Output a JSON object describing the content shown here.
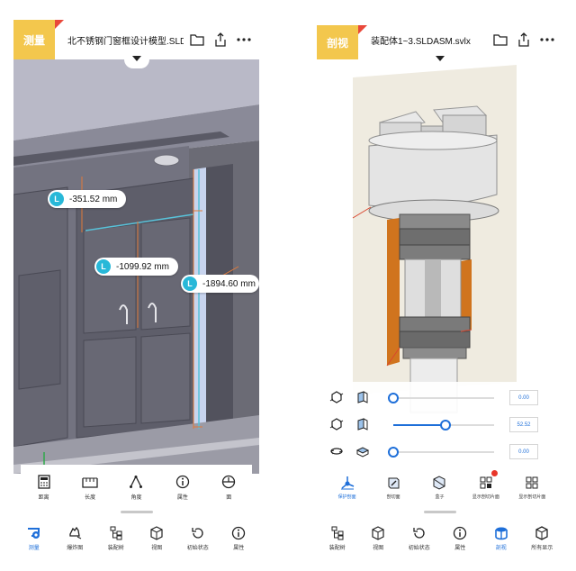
{
  "left_screen": {
    "mode_badge": "测量",
    "file_name": "北不锈钢门窗框设计模型.SLDASM.svlx",
    "measurements": [
      {
        "badge": "L",
        "value": "-351.52 mm"
      },
      {
        "badge": "L",
        "value": "-1099.92 mm"
      },
      {
        "badge": "L",
        "value": "-1894.60 mm"
      }
    ],
    "tools": [
      {
        "icon": "calculator-icon",
        "label": "距离"
      },
      {
        "icon": "ruler-icon",
        "label": "长度"
      },
      {
        "icon": "angle-icon",
        "label": "角度"
      },
      {
        "icon": "info-icon",
        "label": "属性"
      },
      {
        "icon": "dial-icon",
        "label": "面"
      }
    ],
    "nav": [
      {
        "icon": "measure-icon",
        "label": "测量",
        "active": true
      },
      {
        "icon": "hand-icon",
        "label": "爆炸图",
        "active": false
      },
      {
        "icon": "tree-icon",
        "label": "装配树",
        "active": false
      },
      {
        "icon": "cube-view-icon",
        "label": "视图",
        "active": false
      },
      {
        "icon": "reset-icon",
        "label": "初始状态",
        "active": false
      },
      {
        "icon": "info-icon",
        "label": "属性",
        "active": false
      }
    ]
  },
  "right_screen": {
    "mode_badge": "剖视",
    "file_name": "装配体1~3.SLDASM.svlx",
    "sliders": [
      {
        "value": 0.0,
        "display": "0.00"
      },
      {
        "value": 0.52,
        "display": "52.52"
      },
      {
        "value": 0.0,
        "display": "0.00"
      }
    ],
    "tools": [
      {
        "icon": "axis-icon",
        "label": "保护剖面",
        "active": true
      },
      {
        "icon": "cube-edit-icon",
        "label": "剖切面",
        "active": false
      },
      {
        "icon": "section-box-icon",
        "label": "盒子",
        "active": false
      },
      {
        "icon": "grid-mark-icon",
        "label": "显示剖切片面",
        "active": false,
        "badge": true
      },
      {
        "icon": "grid-icon",
        "label": "显示剖切片面",
        "active": false
      }
    ],
    "nav": [
      {
        "icon": "tree-icon",
        "label": "装配树",
        "active": false
      },
      {
        "icon": "cube-view-icon",
        "label": "视图",
        "active": false
      },
      {
        "icon": "reset-icon",
        "label": "初始状态",
        "active": false
      },
      {
        "icon": "info-icon",
        "label": "属性",
        "active": false
      },
      {
        "icon": "section-icon",
        "label": "剖视",
        "active": true
      },
      {
        "icon": "box-icon",
        "label": "所有显示",
        "active": false
      }
    ]
  },
  "colors": {
    "accent": "#1e6fd9",
    "badge_yellow": "#f3c74d",
    "badge_red": "#e9483a",
    "measure_cyan": "#28b8d8"
  }
}
